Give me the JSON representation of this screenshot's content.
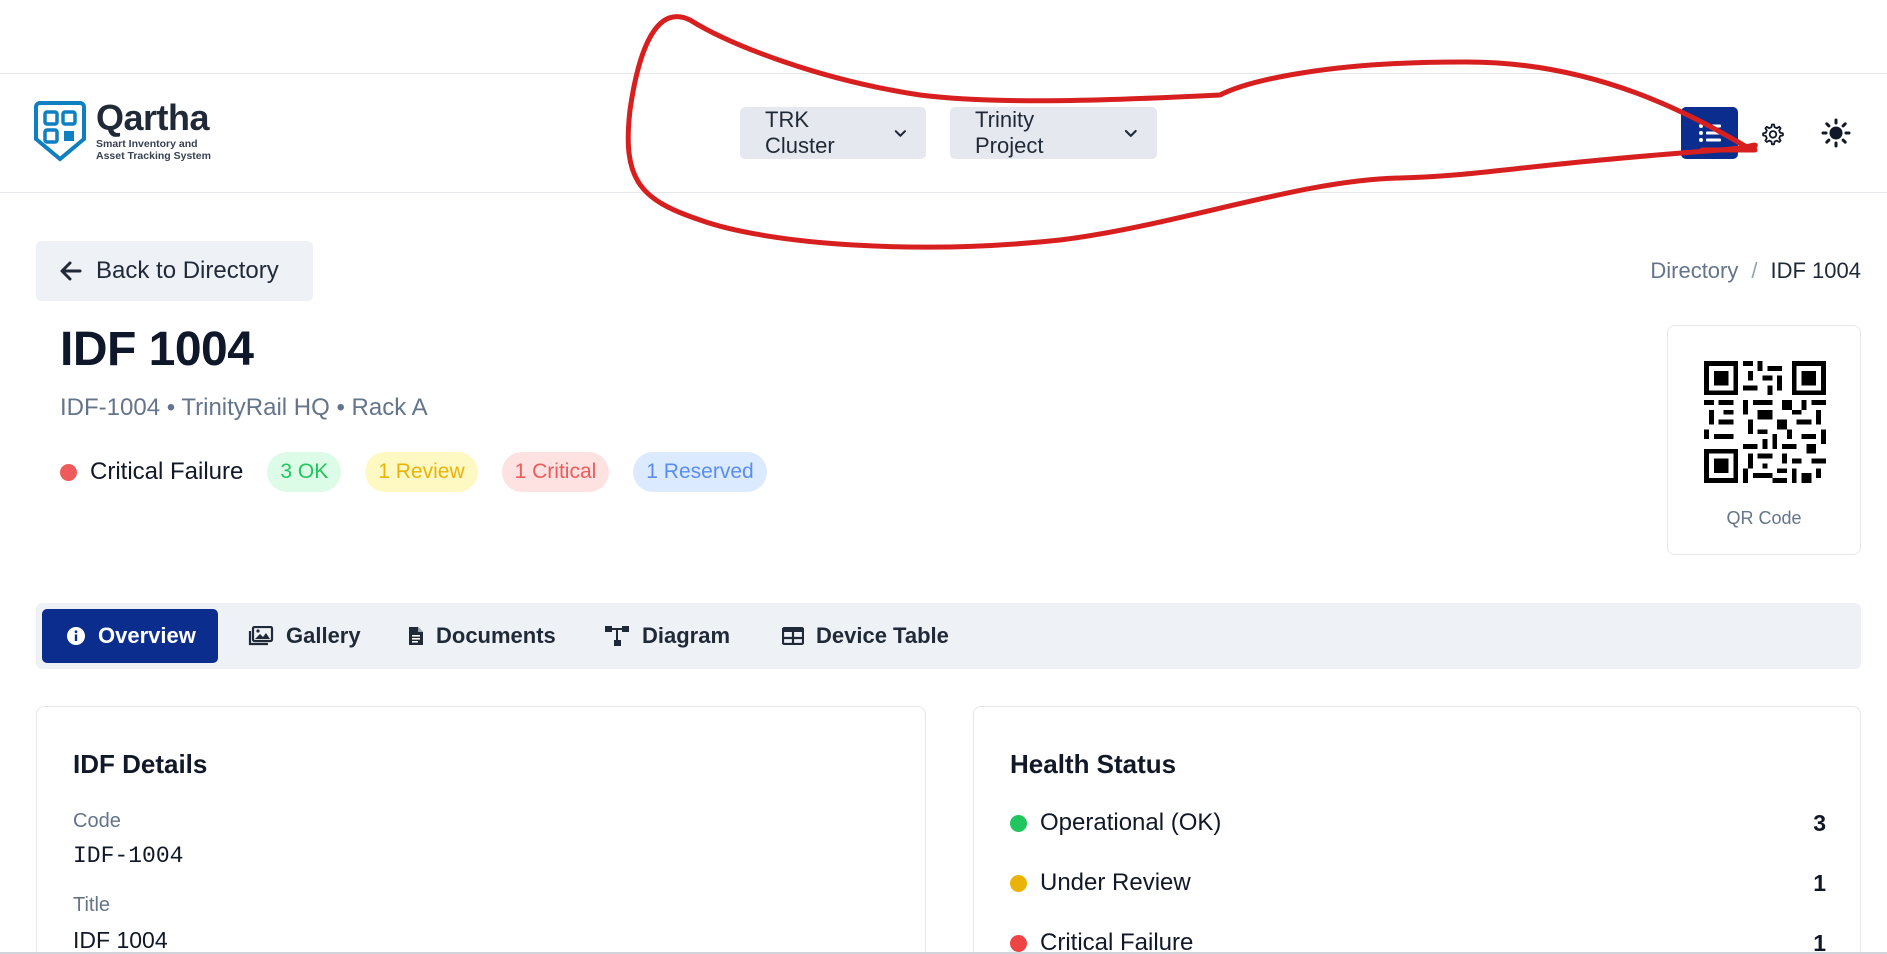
{
  "app": {
    "name": "Qartha",
    "tagline": "Smart Inventory and Asset Tracking System"
  },
  "header": {
    "cluster_select": "TRK Cluster",
    "project_select": "Trinity Project",
    "list_icon": "list-icon",
    "settings_icon": "gear-icon",
    "theme_icon": "sun-icon"
  },
  "nav": {
    "back_label": "Back to Directory",
    "breadcrumb": {
      "parent": "Directory",
      "separator": "/",
      "current": "IDF 1004"
    }
  },
  "page": {
    "title": "IDF 1004",
    "subtitle": "IDF-1004 • TrinityRail HQ • Rack A",
    "status": "Critical Failure",
    "badges": {
      "ok": "3 OK",
      "review": "1 Review",
      "critical": "1 Critical",
      "reserved": "1 Reserved"
    },
    "qr_label": "QR Code"
  },
  "tabs": [
    {
      "label": "Overview",
      "icon": "info-icon"
    },
    {
      "label": "Gallery",
      "icon": "gallery-icon"
    },
    {
      "label": "Documents",
      "icon": "document-icon"
    },
    {
      "label": "Diagram",
      "icon": "diagram-icon"
    },
    {
      "label": "Device Table",
      "icon": "table-icon"
    }
  ],
  "details": {
    "title": "IDF Details",
    "code_label": "Code",
    "code_value": "IDF-1004",
    "title_label": "Title",
    "title_value": "IDF 1004"
  },
  "health": {
    "title": "Health Status",
    "rows": [
      {
        "label": "Operational (OK)",
        "count": "3",
        "color": "#22c55e"
      },
      {
        "label": "Under Review",
        "count": "1",
        "color": "#eab308"
      },
      {
        "label": "Critical Failure",
        "count": "1",
        "color": "#ef4444"
      }
    ]
  },
  "colors": {
    "primary": "#0b2d8e",
    "annotation": "#d81f1f"
  }
}
